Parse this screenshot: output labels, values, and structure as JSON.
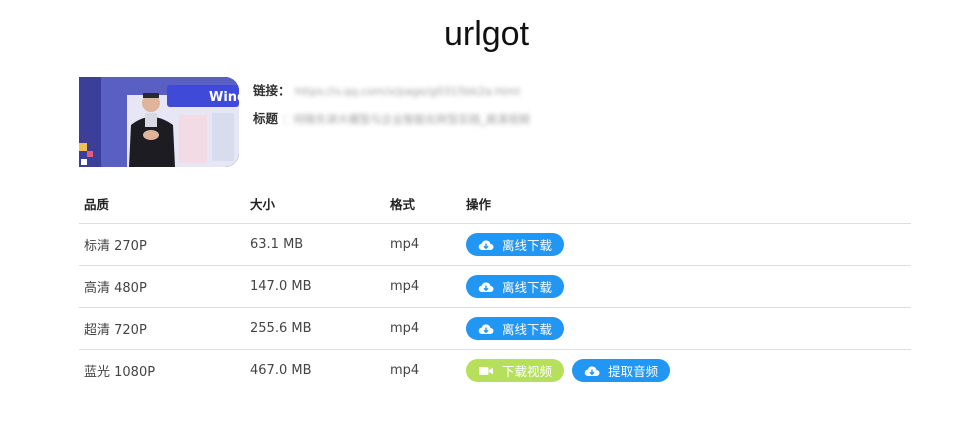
{
  "app": {
    "title": "urlgot"
  },
  "video": {
    "link_label": "链接：",
    "link_value": "https://v.qq.com/x/page/g0315bk2a.html",
    "title_label": "标题",
    "title_value": "：何晓东讲大模型与企业智能化转型实践_高清视频"
  },
  "table": {
    "headers": {
      "quality": "品质",
      "size": "大小",
      "format": "格式",
      "action": "操作"
    },
    "rows": [
      {
        "quality": "标清 270P",
        "size": "63.1 MB",
        "format": "mp4",
        "btn1": "离线下载"
      },
      {
        "quality": "高清 480P",
        "size": "147.0 MB",
        "format": "mp4",
        "btn1": "离线下载"
      },
      {
        "quality": "超清 720P",
        "size": "255.6 MB",
        "format": "mp4",
        "btn1": "离线下载"
      },
      {
        "quality": "蓝光 1080P",
        "size": "467.0 MB",
        "format": "mp4",
        "btn1": "下载视频",
        "btn2": "提取音频"
      }
    ]
  },
  "colors": {
    "primary": "#2196f3",
    "video_button": "#b6e05c",
    "divider": "#dedede"
  },
  "icons": {
    "offline": "cloud-download-icon",
    "video": "video-camera-icon",
    "audio": "cloud-download-icon"
  }
}
